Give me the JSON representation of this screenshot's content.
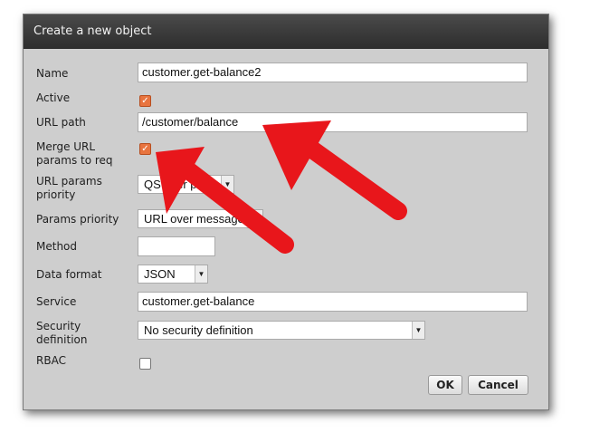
{
  "dialog": {
    "title": "Create a new object"
  },
  "form": {
    "name": {
      "label": "Name",
      "value": "customer.get-balance2"
    },
    "active": {
      "label": "Active",
      "checked": true
    },
    "url_path": {
      "label": "URL path",
      "value": "/customer/balance"
    },
    "merge_url_params": {
      "label_line1": "Merge URL",
      "label_line2": "params to req",
      "checked": true
    },
    "url_params_priority": {
      "label_line1": "URL params",
      "label_line2": "priority",
      "value": "QS over path"
    },
    "params_priority": {
      "label": "Params priority",
      "value": "URL over message"
    },
    "method": {
      "label": "Method",
      "value": ""
    },
    "data_format": {
      "label": "Data format",
      "value": "JSON"
    },
    "service": {
      "label": "Service",
      "value": "customer.get-balance"
    },
    "security_definition": {
      "label_line1": "Security",
      "label_line2": "definition",
      "value": "No security definition"
    },
    "rbac": {
      "label": "RBAC",
      "checked": false
    }
  },
  "buttons": {
    "ok": "OK",
    "cancel": "Cancel"
  },
  "annotation": {
    "arrow_color": "#e8161b"
  }
}
